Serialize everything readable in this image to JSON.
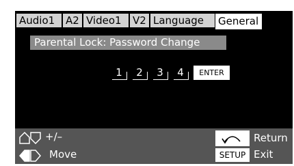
{
  "tabs": [
    {
      "label": "Audio1",
      "active": false
    },
    {
      "label": "A2",
      "active": false
    },
    {
      "label": "Video1",
      "active": false
    },
    {
      "label": "V2",
      "active": false
    },
    {
      "label": "Language",
      "active": false
    },
    {
      "label": "General",
      "active": true
    }
  ],
  "panel": {
    "title": "Parental Lock: Password Change",
    "digits": [
      "1",
      "2",
      "3",
      "4"
    ],
    "enter_label": "ENTER"
  },
  "footer": {
    "adjust_label": "+/–",
    "move_label": "Move",
    "return_label": "Return",
    "setup_label": "SETUP",
    "exit_label": "Exit"
  },
  "icons": {
    "up_down": "up-down-arrows-icon",
    "left_right": "left-right-arrows-icon",
    "return": "return-arrow-icon"
  },
  "colors": {
    "background": "#000000",
    "tab_inactive": "#d3d3d3",
    "tab_active": "#ffffff",
    "title_bar": "#8a8a8a",
    "footer": "#555555"
  }
}
